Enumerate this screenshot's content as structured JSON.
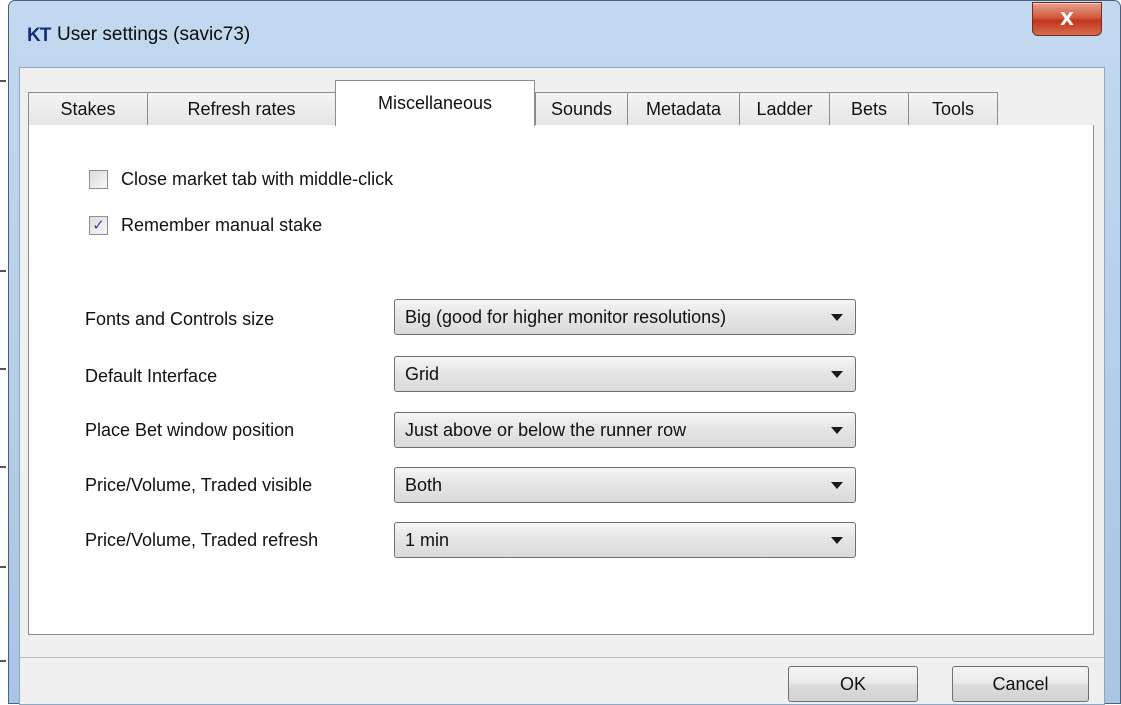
{
  "window": {
    "icon_text": "KT",
    "title": "User settings (savic73)",
    "close_glyph": "X"
  },
  "tabs": [
    {
      "label": "Stakes",
      "active": false
    },
    {
      "label": "Refresh rates",
      "active": false
    },
    {
      "label": "Miscellaneous",
      "active": true
    },
    {
      "label": "Sounds",
      "active": false
    },
    {
      "label": "Metadata",
      "active": false
    },
    {
      "label": "Ladder",
      "active": false
    },
    {
      "label": "Bets",
      "active": false
    },
    {
      "label": "Tools",
      "active": false
    }
  ],
  "checkboxes": [
    {
      "label": "Close market tab with middle-click",
      "checked": false
    },
    {
      "label": "Remember manual stake",
      "checked": true
    }
  ],
  "fields": [
    {
      "label": "Fonts and Controls size",
      "value": "Big (good for higher monitor resolutions)"
    },
    {
      "label": "Default Interface",
      "value": "Grid"
    },
    {
      "label": "Place Bet window position",
      "value": "Just above or below the runner row"
    },
    {
      "label": "Price/Volume, Traded visible",
      "value": "Both"
    },
    {
      "label": "Price/Volume, Traded refresh",
      "value": "1 min"
    }
  ],
  "buttons": {
    "ok": "OK",
    "cancel": "Cancel"
  },
  "check_glyph": "✓",
  "icons": {
    "close": "close-icon",
    "dropdown": "chevron-down-icon"
  }
}
